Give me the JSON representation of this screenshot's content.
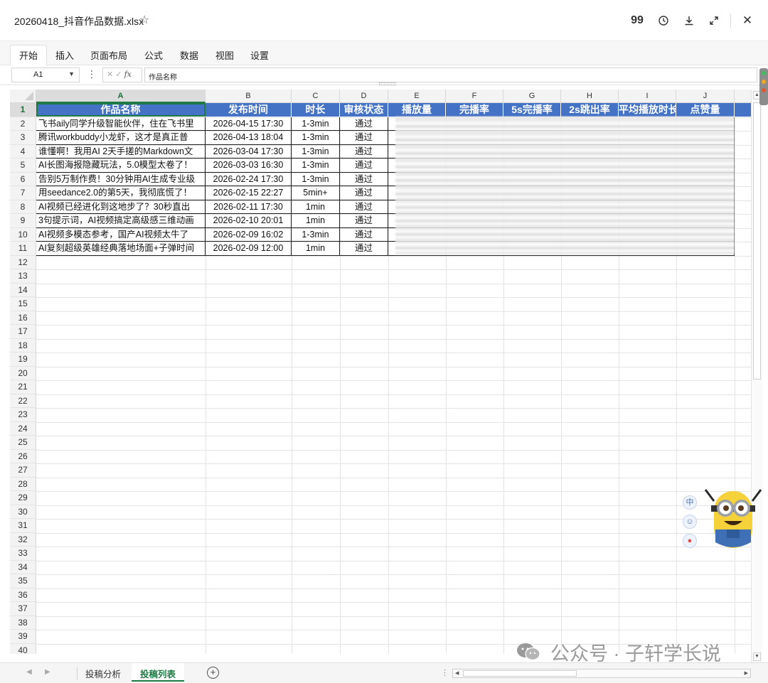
{
  "window": {
    "file_name": "20260418_抖音作品数据.xlsx",
    "star_icon": "star-outline-icon",
    "toolbar_icons": [
      "quote-icon",
      "history-icon",
      "download-icon",
      "expand-icon",
      "close-icon"
    ]
  },
  "ribbon": {
    "tabs": [
      "开始",
      "插入",
      "页面布局",
      "公式",
      "数据",
      "视图",
      "设置"
    ],
    "active_tab": "开始"
  },
  "formula_bar": {
    "cell_ref": "A1",
    "content": "作品名称"
  },
  "columns": [
    "A",
    "B",
    "C",
    "D",
    "E",
    "F",
    "G",
    "H",
    "I",
    "J"
  ],
  "rows": [
    "1",
    "2",
    "3",
    "4",
    "5",
    "6",
    "7",
    "8",
    "9",
    "10",
    "11",
    "12",
    "13",
    "14",
    "15",
    "16",
    "17",
    "18",
    "19",
    "20",
    "21",
    "22",
    "23",
    "24",
    "25",
    "26",
    "27",
    "28",
    "29",
    "30",
    "31",
    "32",
    "33",
    "34",
    "35",
    "36",
    "37",
    "38",
    "39",
    "40"
  ],
  "table": {
    "headers": [
      "作品名称",
      "发布时间",
      "时长",
      "审核状态",
      "播放量",
      "完播率",
      "5s完播率",
      "2s跳出率",
      "平均播放时长",
      "点赞量"
    ],
    "rows": [
      [
        "飞书aily同学升级智能伙伴，住在飞书里",
        "2026-04-15 17:30",
        "1-3min",
        "通过"
      ],
      [
        "腾讯workbuddy小龙虾，这才是真正普",
        "2026-04-13 18:04",
        "1-3min",
        "通过"
      ],
      [
        "谁懂啊！我用AI 2天手搓的Markdown文",
        "2026-03-04 17:30",
        "1-3min",
        "通过"
      ],
      [
        "AI长图海报隐藏玩法，5.0模型太卷了！",
        "2026-03-03 16:30",
        "1-3min",
        "通过"
      ],
      [
        "告别5万制作费！30分钟用AI生成专业级",
        "2026-02-24 17:30",
        "1-3min",
        "通过"
      ],
      [
        "用seedance2.0的第5天，我彻底慌了！",
        "2026-02-15 22:27",
        "5min+",
        "通过"
      ],
      [
        "AI视频已经进化到这地步了？30秒直出",
        "2026-02-11 17:30",
        "1min",
        "通过"
      ],
      [
        "3句提示词，AI视频搞定高级感三维动画",
        "2026-02-10 20:01",
        "1min",
        "通过"
      ],
      [
        "AI视频多模态参考，国产AI视频太牛了",
        "2026-02-09 16:02",
        "1-3min",
        "通过"
      ],
      [
        "AI复刻超级英雄经典落地场面+子弹时间",
        "2026-02-09 12:00",
        "1min",
        "通过"
      ]
    ]
  },
  "floating_tools": [
    "中",
    "☺",
    "●"
  ],
  "watermark": "公众号 · 子轩学长说",
  "sheets": {
    "tabs": [
      "投稿分析",
      "投稿列表"
    ],
    "active": "投稿列表"
  },
  "colors": {
    "header_fill": "#4472c4",
    "accent_green": "#1e7b45"
  }
}
